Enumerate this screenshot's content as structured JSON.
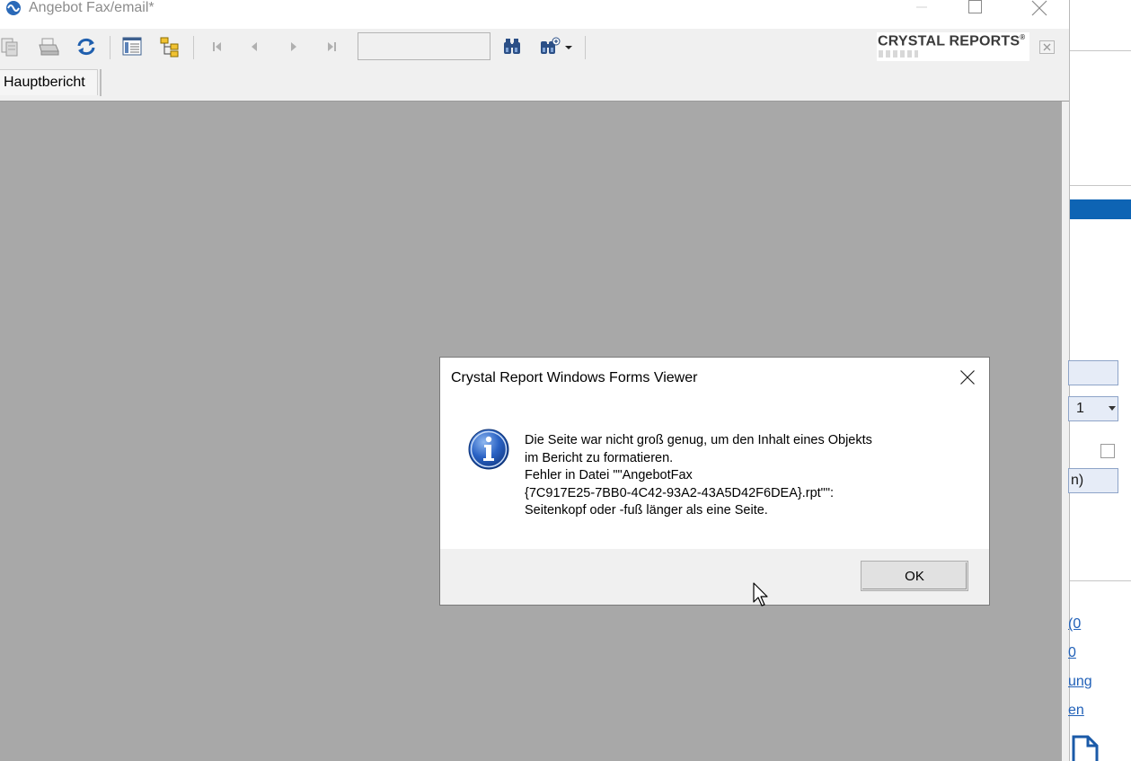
{
  "window": {
    "title": "Angebot Fax/email*"
  },
  "toolbar": {
    "page_input_value": "",
    "logo_text": "CRYSTAL REPORTS",
    "logo_mark": "®"
  },
  "tabs": [
    {
      "label": "Hauptbericht"
    }
  ],
  "background_app": {
    "select_value": "1",
    "field_value": "n)",
    "links": [
      "(0",
      "0",
      "ung",
      "en"
    ]
  },
  "dialog": {
    "title": "Crystal Report Windows Forms Viewer",
    "message": "Die Seite war nicht groß genug, um den Inhalt eines Objekts\nim Bericht zu formatieren.\nFehler in Datei \"\"AngebotFax\n{7C917E25-7BB0-4C42-93A2-43A5D42F6DEA}.rpt\"\":\nSeitenkopf oder -fuß länger als eine Seite.",
    "ok_label": "OK"
  },
  "colors": {
    "report_background": "#a8a8a8",
    "dialog_footer": "#f0f0f0",
    "accent_blue": "#0e64b4"
  }
}
